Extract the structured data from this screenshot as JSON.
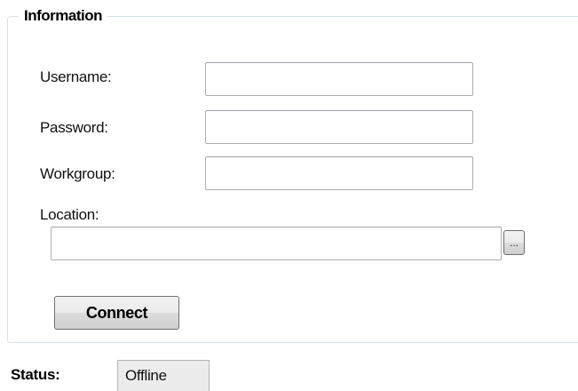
{
  "group": {
    "title": "Information"
  },
  "fields": {
    "username": {
      "label": "Username:",
      "value": ""
    },
    "password": {
      "label": "Password:",
      "value": ""
    },
    "workgroup": {
      "label": "Workgroup:",
      "value": ""
    },
    "location": {
      "label": "Location:",
      "value": ""
    }
  },
  "buttons": {
    "browse_label": "...",
    "connect_label": "Connect"
  },
  "status": {
    "label": "Status:",
    "value": "Offline"
  }
}
